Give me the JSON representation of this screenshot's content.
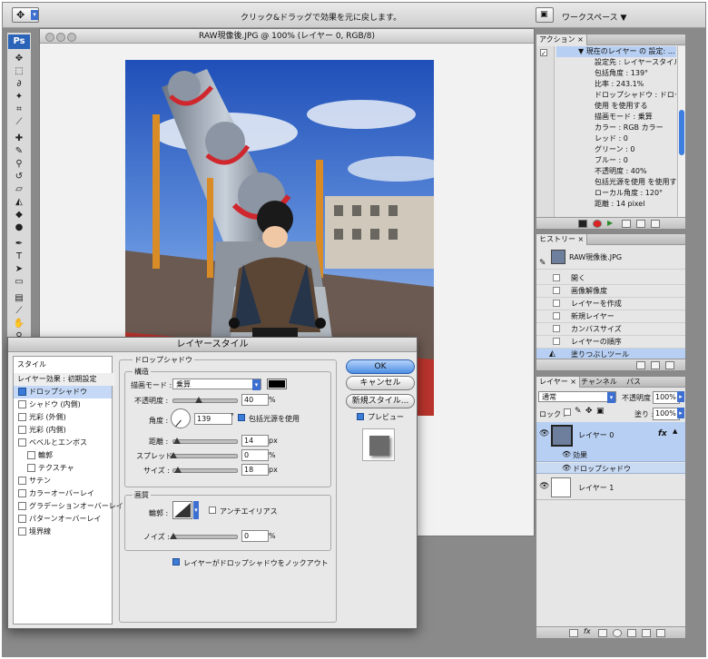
{
  "options_bar": {
    "hint": "クリック&ドラッグで効果を元に戻します。",
    "workspace": "ワークスペース ▼"
  },
  "toolbox": {
    "logo": "Ps"
  },
  "document": {
    "title": "RAW現像後.JPG @ 100% (レイヤー 0, RGB/8)"
  },
  "actions_panel": {
    "tab": "アクション",
    "items": [
      "現在のレイヤー の 設定: ...",
      "設定先 : レイヤースタイル",
      "包括角度 : 139°",
      "比率 : 243.1%",
      "ドロップシャドウ : ドロップ...",
      "使用 を使用する",
      "描画モード : 乗算",
      "カラー : RGB カラー",
      "レッド : 0",
      "グリーン : 0",
      "ブルー : 0",
      "不透明度 : 40%",
      "包括光源を使用 を使用する",
      "ローカル角度 : 120°",
      "距離 : 14 pixel"
    ]
  },
  "history_panel": {
    "tab": "ヒストリー",
    "snapshot": "RAW現像後.JPG",
    "items": [
      "開く",
      "画像解像度",
      "レイヤーを作成",
      "新規レイヤー",
      "カンバスサイズ",
      "レイヤーの順序",
      "塗りつぶしツール"
    ]
  },
  "layers_panel": {
    "tabs": [
      "レイヤー",
      "チャンネル",
      "パス"
    ],
    "blend_mode": "通常",
    "opacity_label": "不透明度 :",
    "opacity_value": "100%",
    "lock_label": "ロック :",
    "fill_label": "塗り :",
    "fill_value": "100%",
    "layers": [
      {
        "name": "レイヤー 0",
        "fx": "fx",
        "effects_label": "効果",
        "effect": "ドロップシャドウ"
      },
      {
        "name": "レイヤー 1"
      }
    ]
  },
  "dialog": {
    "title": "レイヤースタイル",
    "styles_header": "スタイル",
    "blend_options": "レイヤー効果 : 初期設定",
    "styles": [
      {
        "label": "ドロップシャドウ",
        "checked": true
      },
      {
        "label": "シャドウ (内側)",
        "checked": false
      },
      {
        "label": "光彩 (外側)",
        "checked": false
      },
      {
        "label": "光彩 (内側)",
        "checked": false
      },
      {
        "label": "ベベルとエンボス",
        "checked": false
      },
      {
        "label": "輪郭",
        "checked": false
      },
      {
        "label": "テクスチャ",
        "checked": false
      },
      {
        "label": "サテン",
        "checked": false
      },
      {
        "label": "カラーオーバーレイ",
        "checked": false
      },
      {
        "label": "グラデーションオーバーレイ",
        "checked": false
      },
      {
        "label": "パターンオーバーレイ",
        "checked": false
      },
      {
        "label": "境界線",
        "checked": false
      }
    ],
    "section_title": "ドロップシャドウ",
    "structure_title": "構造",
    "blend_mode_label": "描画モード :",
    "blend_mode_value": "乗算",
    "shadow_color": "#000000",
    "opacity_label": "不透明度 :",
    "opacity_value": "40",
    "angle_label": "角度 :",
    "angle_value": "139",
    "degree": "°",
    "global_light_label": "包括光源を使用",
    "distance_label": "距離 :",
    "distance_value": "14",
    "spread_label": "スプレッド :",
    "spread_value": "0",
    "size_label": "サイズ :",
    "size_value": "18",
    "quality_title": "画質",
    "contour_label": "輪郭 :",
    "antialias_label": "アンチエイリアス",
    "noise_label": "ノイズ :",
    "noise_value": "0",
    "knockout_label": "レイヤーがドロップシャドウをノックアウト",
    "unit_pct": "%",
    "unit_px": "px",
    "buttons": {
      "ok": "OK",
      "cancel": "キャンセル",
      "new_style": "新規スタイル...",
      "preview": "プレビュー"
    }
  }
}
